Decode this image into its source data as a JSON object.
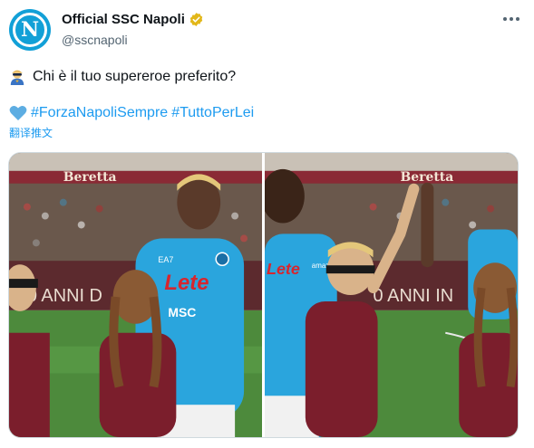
{
  "author": {
    "display_name": "Official SSC Napoli",
    "handle": "@sscnapoli",
    "avatar_letter": "N",
    "verified": true
  },
  "tweet": {
    "line1_text": "Chi è il tuo supereroe preferito?",
    "hashtag1": "#ForzaNapoliSempre",
    "hashtag2": "#TuttoPerLei",
    "translate_label": "翻译推文"
  },
  "media": {
    "sponsor_board": "Beretta",
    "board_text": "0 ANNI D",
    "board_text_right": "0 ANNI IN",
    "shirt_sponsor": "Lete",
    "shirt_brand": "EA7",
    "shirt_sub_sponsor": "MSC",
    "shirt_sleeve_sponsor": "amazon"
  },
  "colors": {
    "accent": "#1d9bf0",
    "napoli_blue": "#12a0d7",
    "torino_maroon": "#7b1e2c",
    "verified_gold": "#e2b719"
  },
  "icons": [
    "avatar-napoli-logo",
    "verified-gold-badge",
    "more-options-icon",
    "superhero-emoji",
    "blue-heart-emoji"
  ]
}
